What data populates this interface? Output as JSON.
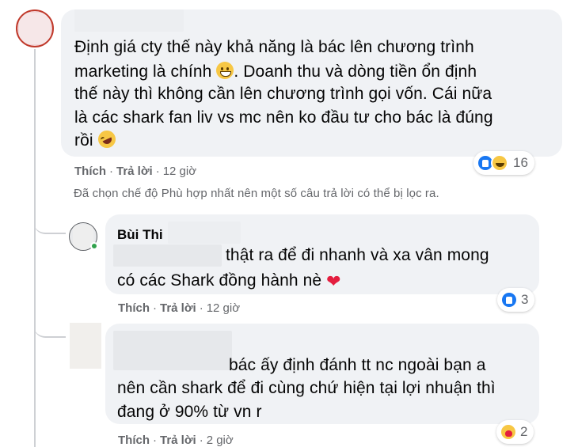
{
  "main_comment": {
    "lines": [
      "Định giá cty thế này khả năng là bác lên chương trình",
      "marketing là chính",
      "thế này thì không cần lên chương trình gọi vốn. Cái nữa",
      "là các shark fan liv vs mc nên ko đầu tư cho bác là đúng",
      "rồi"
    ],
    "line2_after_emoji": ". Doanh thu và dòng tiền ổn định",
    "emoji_1": "grinning-face",
    "emoji_2": "rolling-on-floor-laughing",
    "like_label": "Thích",
    "reply_label": "Trả lời",
    "time": "12 giờ",
    "reaction_count": "16",
    "reactions": [
      "like",
      "haha"
    ]
  },
  "filter_notice": "Đã chọn chế độ Phù hợp nhất nên một số câu trả lời có thể bị lọc ra.",
  "reply_1": {
    "author": "Bùi Thi",
    "line1": "thật ra để đi nhanh và xa vân mong",
    "line2": "có các Shark đồng hành nè",
    "like_label": "Thích",
    "reply_label": "Trả lời",
    "time": "12 giờ",
    "reaction_count": "3",
    "reactions": [
      "like"
    ]
  },
  "reply_2": {
    "line1": "bác ấy định đánh tt nc ngoài bạn a",
    "line2": "nên cần shark để đi cùng chứ hiện tại lợi nhuận thì",
    "line3": "đang ở 90% từ vn r",
    "like_label": "Thích",
    "reply_label": "Trả lời",
    "time": "2 giờ",
    "reaction_count": "2",
    "reactions": [
      "care"
    ]
  },
  "colors": {
    "bubble": "#f0f2f5",
    "meta_text": "#65676b",
    "like_blue": "#1877f2",
    "online_green": "#31a24c",
    "heart_red": "#e41e3f"
  }
}
